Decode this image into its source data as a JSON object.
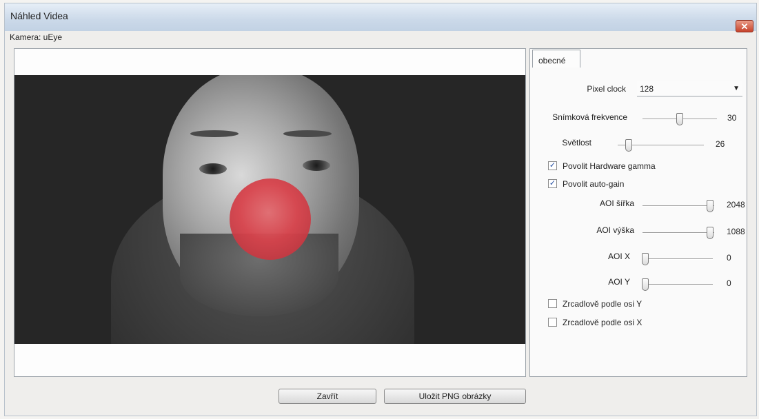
{
  "window": {
    "title": "Náhled Videa",
    "close_glyph": "✕"
  },
  "camera": {
    "label": "Kamera: uEye"
  },
  "tabs": [
    {
      "label": "obecné"
    }
  ],
  "settings": {
    "pixel_clock": {
      "label": "Pixel clock",
      "value": "128"
    },
    "frame_rate": {
      "label": "Snímková frekvence",
      "value": "30"
    },
    "brightness": {
      "label": "Světlost",
      "value": "26"
    },
    "hardware_gamma": {
      "label": "Povolit Hardware gamma",
      "checked": true
    },
    "auto_gain": {
      "label": "Povolit auto-gain",
      "checked": true
    },
    "aoi_width": {
      "label": "AOI šířka",
      "value": "2048"
    },
    "aoi_height": {
      "label": "AOI výška",
      "value": "1088"
    },
    "aoi_x": {
      "label": "AOI X",
      "value": "0"
    },
    "aoi_y": {
      "label": "AOI Y",
      "value": "0"
    },
    "mirror_y": {
      "label": "Zrcadlově podle osi Y",
      "checked": false
    },
    "mirror_x": {
      "label": "Zrcadlově podle osi X",
      "checked": false
    }
  },
  "buttons": {
    "close": "Zavřít",
    "save_png": "Uložit PNG obrázky"
  },
  "icons": {
    "combo_arrow": "chevron-down-icon",
    "check": "checkmark-icon",
    "close": "close-icon"
  },
  "colors": {
    "close_button": "#c7432c",
    "overlay_circle": "#d9414a"
  }
}
